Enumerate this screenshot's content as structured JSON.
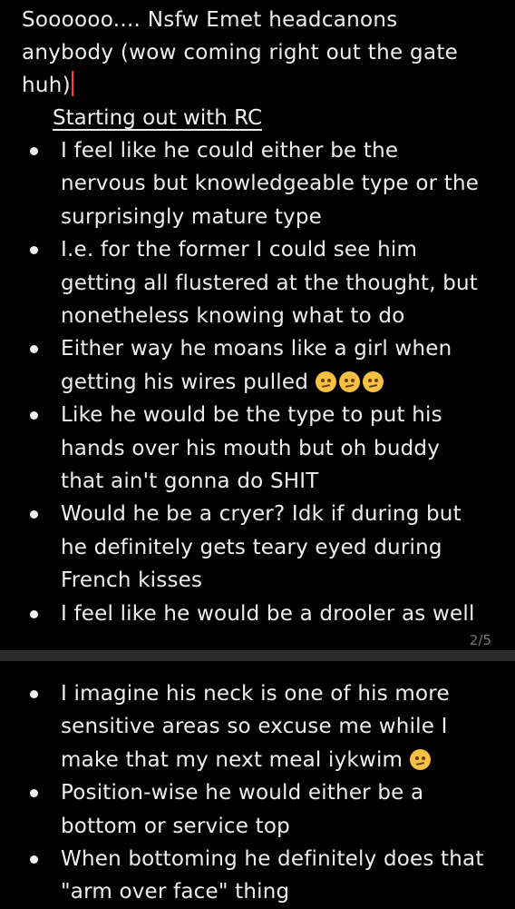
{
  "note1": {
    "intro": "Soooooo.... Nsfw Emet headcanons anybody (wow coming right out the gate huh)",
    "section_heading": "Starting out with RC",
    "bullets": [
      "I feel like he could either be the nervous but knowledgeable type or the surprisingly mature type",
      "I.e. for the former I could see him getting all flustered at the thought, but nonetheless knowing what to do",
      "Either way he moans like a girl when getting his wires pulled",
      "Like he would be the type to put his hands over his mouth but oh buddy that ain't gonna do SHIT",
      "Would he be a cryer? Idk if during but he definitely gets teary eyed during French kisses",
      "I feel like he would be a drooler as well"
    ],
    "page_indicator": "2/5"
  },
  "note2": {
    "bullets": [
      "I imagine his neck is one of his more sensitive areas so excuse me while I make that my next meal iykwim",
      "Position-wise he would either be a bottom or service top",
      "When bottoming he definitely does that \"arm over face\" thing"
    ]
  },
  "icons": {
    "emoji": "woozy-face-icon"
  },
  "colors": {
    "background": "#000000",
    "text": "#eeeeee",
    "caret": "#ff3b30",
    "divider": "#2a2a2a"
  }
}
